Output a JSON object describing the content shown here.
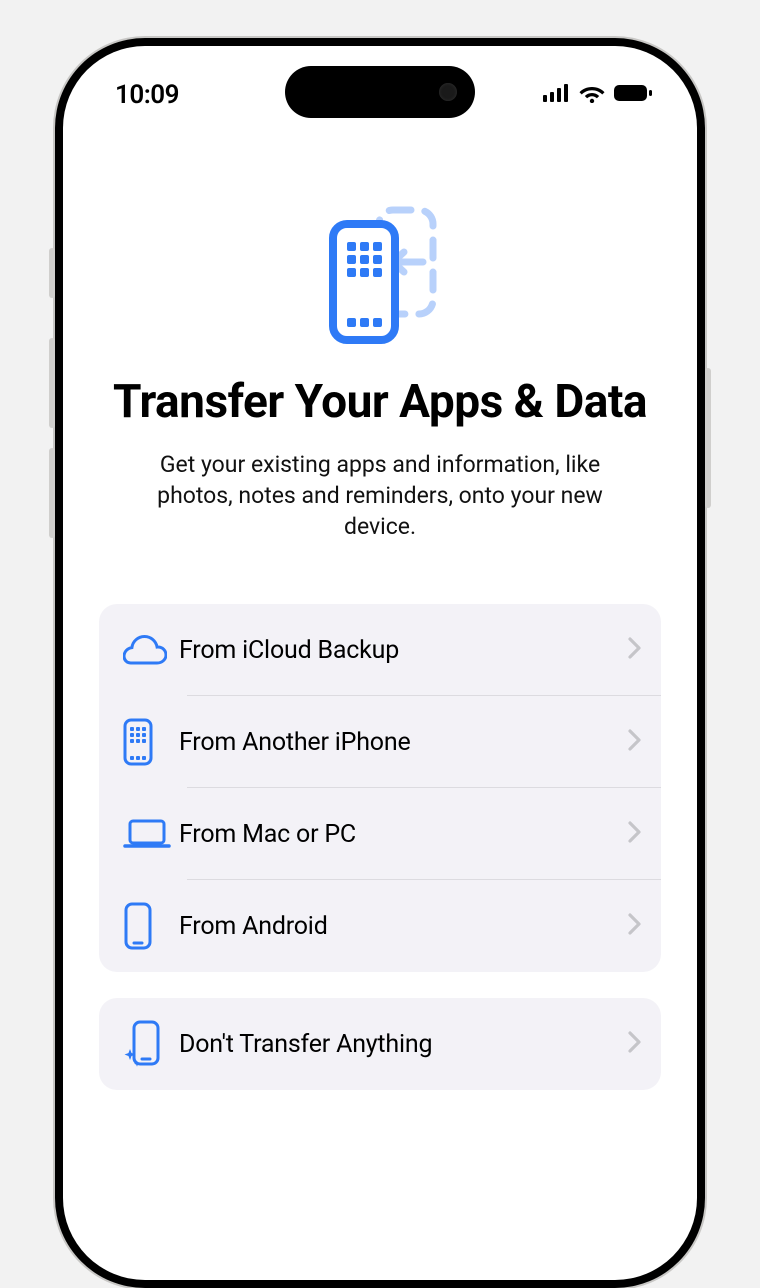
{
  "status": {
    "time": "10:09"
  },
  "header": {
    "title": "Transfer Your Apps & Data",
    "subtitle": "Get your existing apps and information, like photos, notes and reminders, onto your new device."
  },
  "options": {
    "group1": [
      {
        "label": "From iCloud Backup",
        "icon": "cloud"
      },
      {
        "label": "From Another iPhone",
        "icon": "iphone-grid"
      },
      {
        "label": "From Mac or PC",
        "icon": "laptop"
      },
      {
        "label": "From Android",
        "icon": "phone-outline"
      }
    ],
    "group2": [
      {
        "label": "Don't Transfer Anything",
        "icon": "phone-sparkle"
      }
    ]
  },
  "colors": {
    "accent": "#2e7af6",
    "accentLight": "#b8d1fb",
    "chevron": "#c5c5c9",
    "groupBg": "#f3f2f7"
  }
}
